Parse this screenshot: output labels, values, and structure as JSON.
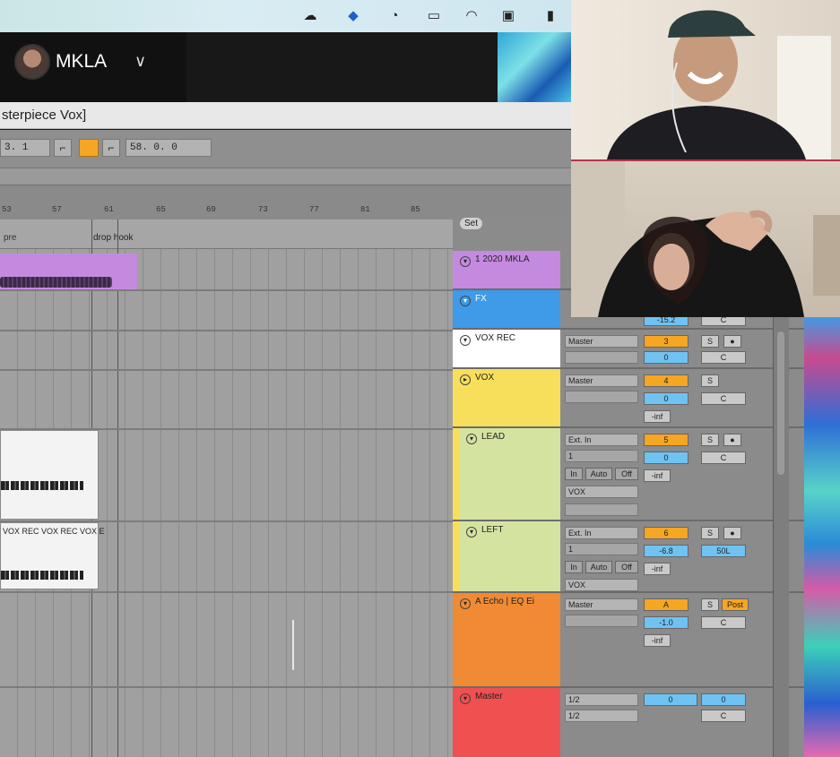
{
  "zoom": {
    "user_name": "MKLA",
    "chevron": "chevron-down-icon"
  },
  "daw": {
    "window_title": "sterpiece Vox]",
    "transport": {
      "position": "3. 1",
      "end": "58. 0. 0"
    },
    "ruler": [
      "53",
      "57",
      "61",
      "65",
      "69",
      "73",
      "77",
      "81",
      "85"
    ],
    "locators": {
      "pre": "pre",
      "drop": "drop hook"
    },
    "clip_labels": "VOX REC  VOX REC  VOX E",
    "set_label": "Set",
    "tracks": [
      {
        "name": "1 2020 MKLA",
        "color": "#c48ae0"
      },
      {
        "name": "FX",
        "color": "#3f9ae8"
      },
      {
        "name": "VOX REC",
        "color": "#ffffff",
        "route": "Master",
        "num": "3",
        "vol": "0",
        "pan": "C"
      },
      {
        "name": "VOX",
        "color": "#f7df5c",
        "route": "Master",
        "num": "4",
        "vol": "0",
        "pan": "C",
        "inf": "-inf"
      },
      {
        "name": "LEAD",
        "color": "#d5e3a0",
        "route": "Ext. In",
        "ch": "1",
        "mon_in": "In",
        "mon_auto": "Auto",
        "mon_off": "Off",
        "dest": "VOX",
        "num": "5",
        "vol": "0",
        "pan": "C",
        "inf": "-inf"
      },
      {
        "name": "LEFT",
        "color": "#d5e3a0",
        "route": "Ext. In",
        "ch": "1",
        "mon_in": "In",
        "mon_auto": "Auto",
        "mon_off": "Off",
        "dest": "VOX",
        "num": "6",
        "vol": "-6.8",
        "pan": "50L",
        "inf": "-inf"
      },
      {
        "name": "A Echo | EQ Ei",
        "color": "#f08a35",
        "route": "Master",
        "num": "A",
        "vol": "-1.0",
        "pan": "C",
        "inf": "-inf",
        "post": "Post"
      },
      {
        "name": "Master",
        "color": "#f05050",
        "route": "1/2",
        "route2": "1/2",
        "num": "0",
        "vol": "0",
        "pan": "C"
      }
    ],
    "fx_readout": "-15.2",
    "fx_pan": "C",
    "solo": "S",
    "rec": "●"
  }
}
